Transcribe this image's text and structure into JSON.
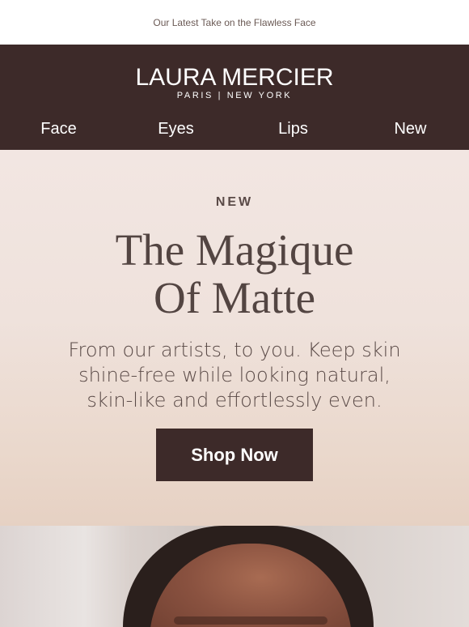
{
  "preheader": {
    "text": "Our Latest Take on the Flawless Face"
  },
  "brand": {
    "logo_text": "LAURA MERCIER",
    "logo_sub": "PARIS | NEW YORK"
  },
  "nav": {
    "items": [
      {
        "label": "Face"
      },
      {
        "label": "Eyes"
      },
      {
        "label": "Lips"
      },
      {
        "label": "New"
      }
    ]
  },
  "hero": {
    "eyebrow": "NEW",
    "headline_line1": "The Magique",
    "headline_line2": "Of Matte",
    "body": "From our artists, to you. Keep skin shine-free while looking natural, skin-like and effortlessly even.",
    "cta_label": "Shop Now"
  },
  "colors": {
    "brand_dark": "#3d2a29",
    "hero_bg_top": "#f2e6e2",
    "hero_bg_bottom": "#e6d1c3",
    "text_muted": "#5a4a47"
  }
}
